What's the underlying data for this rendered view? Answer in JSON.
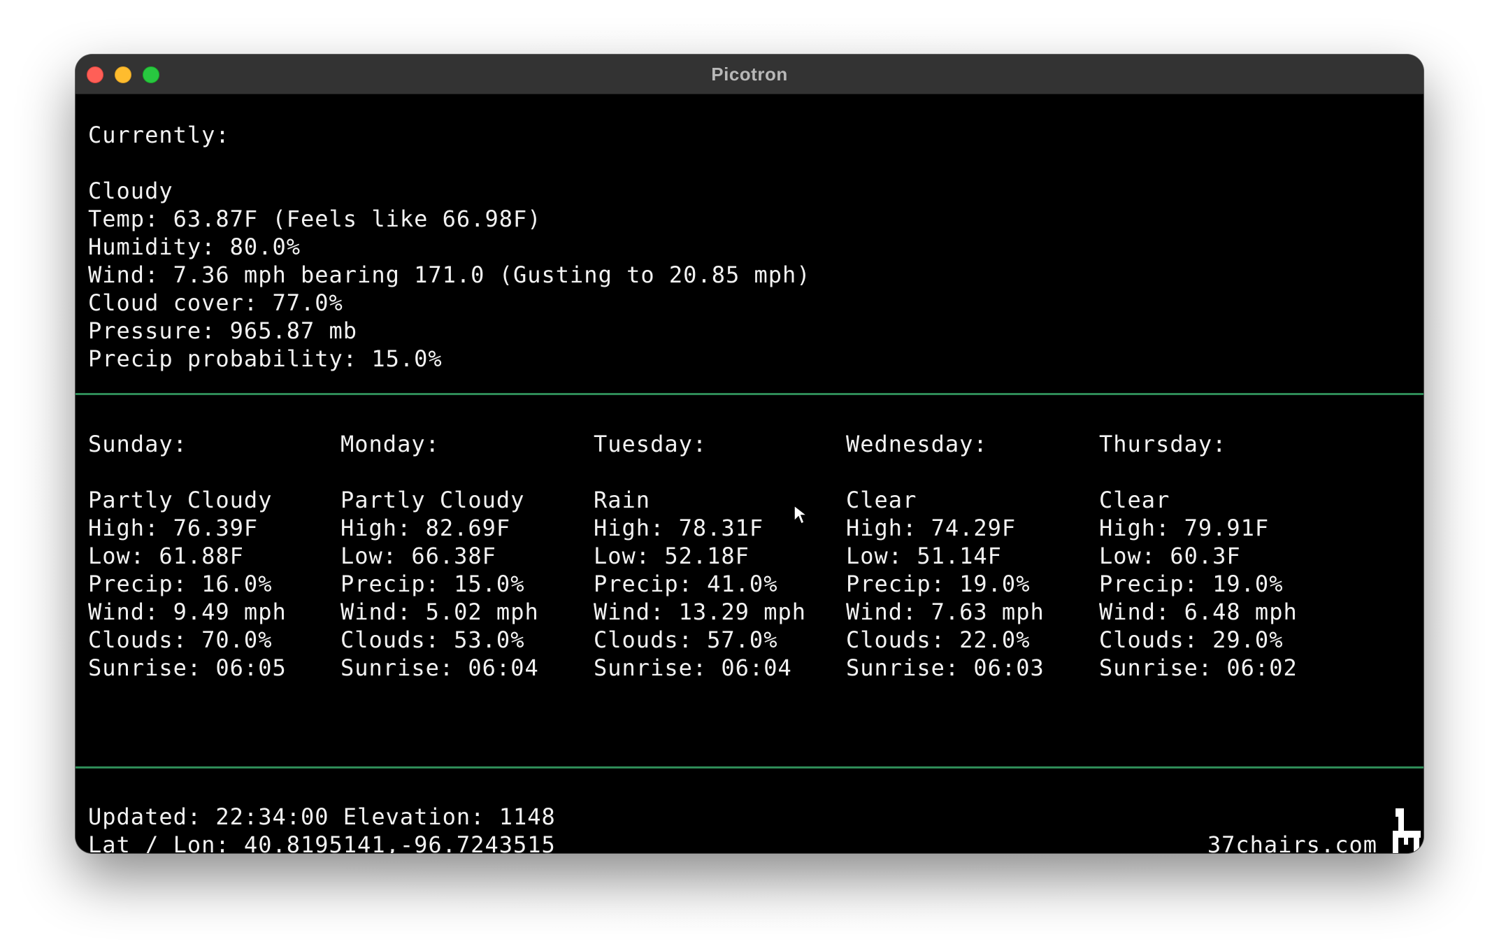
{
  "window": {
    "title": "Picotron"
  },
  "current": {
    "heading": "Currently:",
    "condition": "Cloudy",
    "temp": "Temp: 63.87F (Feels like 66.98F)",
    "humidity": "Humidity: 80.0%",
    "wind": "Wind: 7.36 mph bearing 171.0 (Gusting to 20.85 mph)",
    "cloud_cover": "Cloud cover: 77.0%",
    "pressure": "Pressure: 965.87 mb",
    "precip_probability": "Precip probability: 15.0%"
  },
  "forecast": [
    {
      "day": "Sunday:",
      "condition": "Partly Cloudy",
      "high": "High: 76.39F",
      "low": "Low: 61.88F",
      "precip": "Precip: 16.0%",
      "wind": "Wind: 9.49 mph",
      "clouds": "Clouds: 70.0%",
      "sunrise": "Sunrise: 06:05"
    },
    {
      "day": "Monday:",
      "condition": "Partly Cloudy",
      "high": "High: 82.69F",
      "low": "Low: 66.38F",
      "precip": "Precip: 15.0%",
      "wind": "Wind: 5.02 mph",
      "clouds": "Clouds: 53.0%",
      "sunrise": "Sunrise: 06:04"
    },
    {
      "day": "Tuesday:",
      "condition": "Rain",
      "high": "High: 78.31F",
      "low": "Low: 52.18F",
      "precip": "Precip: 41.0%",
      "wind": "Wind: 13.29 mph",
      "clouds": "Clouds: 57.0%",
      "sunrise": "Sunrise: 06:04"
    },
    {
      "day": "Wednesday:",
      "condition": "Clear",
      "high": "High: 74.29F",
      "low": "Low: 51.14F",
      "precip": "Precip: 19.0%",
      "wind": "Wind: 7.63 mph",
      "clouds": "Clouds: 22.0%",
      "sunrise": "Sunrise: 06:03"
    },
    {
      "day": "Thursday:",
      "condition": "Clear",
      "high": "High: 79.91F",
      "low": "Low: 60.3F",
      "precip": "Precip: 19.0%",
      "wind": "Wind: 6.48 mph",
      "clouds": "Clouds: 29.0%",
      "sunrise": "Sunrise: 06:02"
    }
  ],
  "footer": {
    "updated": "Updated: 22:34:00 Elevation: 1148",
    "latlon": "Lat / Lon: 40.8195141,-96.7243515",
    "credit": "37chairs.com"
  },
  "icons": {
    "cursor": "mouse-pointer-icon",
    "logo": "chair-logo-icon"
  },
  "colors": {
    "divider": "#2e8b57",
    "text": "#f2f2f2",
    "background": "#000000"
  }
}
